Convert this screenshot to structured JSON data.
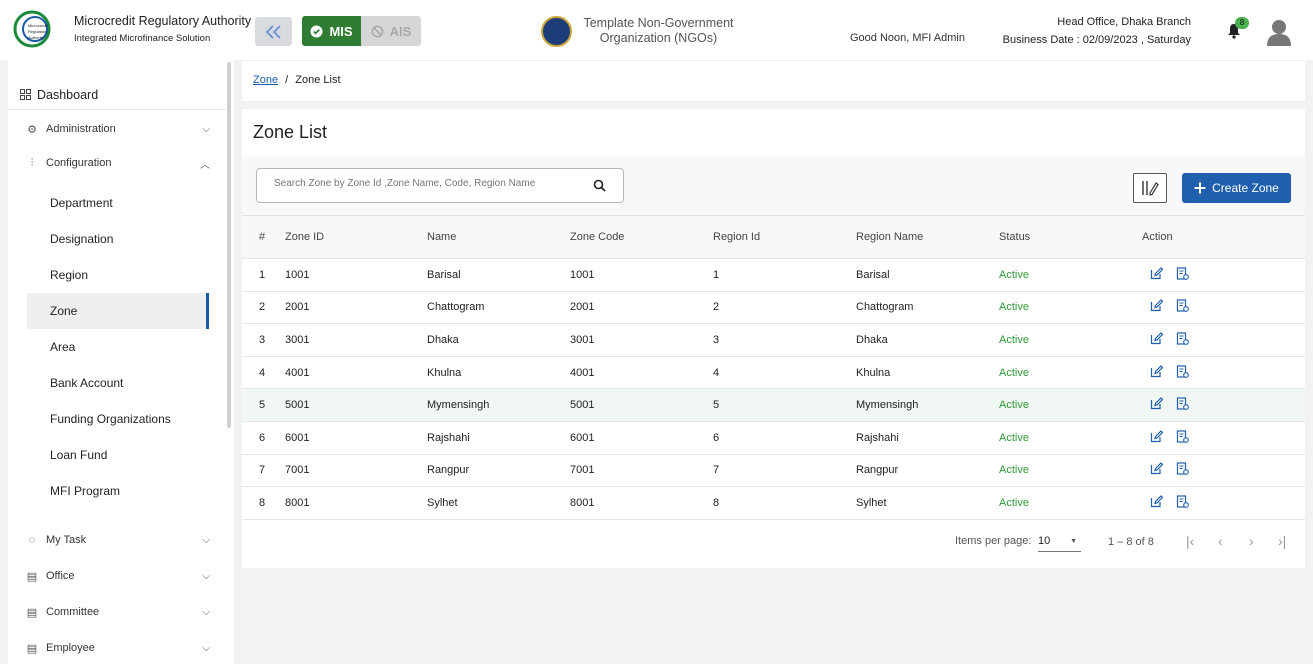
{
  "header": {
    "org_title": "Microcredit Regulatory Authority",
    "org_subtitle": "Integrated Microfinance Solution",
    "logo_text": "Microcredit Regulatory Authority",
    "mis_label": "MIS",
    "ais_label": "AIS",
    "ngo_name": "Template Non-Government Organization (NGOs)",
    "greeting": "Good Noon, MFI Admin",
    "branch": "Head Office, Dhaka Branch",
    "business_date": "Business Date : 02/09/2023 , Saturday",
    "notification_count": "8"
  },
  "sidebar": {
    "dashboard": "Dashboard",
    "items": [
      {
        "label": "Administration",
        "icon": "users-cog-icon",
        "chevron": "down"
      },
      {
        "label": "Configuration",
        "icon": "sliders-icon",
        "chevron": "up"
      }
    ],
    "config_children": [
      "Department",
      "Designation",
      "Region",
      "Zone",
      "Area",
      "Bank Account",
      "Funding Organizations",
      "Loan Fund",
      "MFI Program"
    ],
    "active_child": "Zone",
    "bottom_items": [
      {
        "label": "My Task",
        "icon": "task-icon"
      },
      {
        "label": "Office",
        "icon": "office-icon"
      },
      {
        "label": "Committee",
        "icon": "committee-icon"
      },
      {
        "label": "Employee",
        "icon": "employee-icon"
      }
    ]
  },
  "breadcrumb": {
    "link": "Zone",
    "separator": "/",
    "current": "Zone List"
  },
  "page": {
    "title": "Zone List",
    "search_placeholder": "Search Zone by Zone Id ,Zone Name, Code, Region Name",
    "create_label": "Create Zone"
  },
  "table": {
    "headers": [
      "#",
      "Zone ID",
      "Name",
      "Zone Code",
      "Region Id",
      "Region Name",
      "Status",
      "Action"
    ],
    "rows": [
      [
        "1",
        "1001",
        "Barisal",
        "1001",
        "1",
        "Barisal",
        "Active"
      ],
      [
        "2",
        "2001",
        "Chattogram",
        "2001",
        "2",
        "Chattogram",
        "Active"
      ],
      [
        "3",
        "3001",
        "Dhaka",
        "3001",
        "3",
        "Dhaka",
        "Active"
      ],
      [
        "4",
        "4001",
        "Khulna",
        "4001",
        "4",
        "Khulna",
        "Active"
      ],
      [
        "5",
        "5001",
        "Mymensingh",
        "5001",
        "5",
        "Mymensingh",
        "Active"
      ],
      [
        "6",
        "6001",
        "Rajshahi",
        "6001",
        "6",
        "Rajshahi",
        "Active"
      ],
      [
        "7",
        "7001",
        "Rangpur",
        "7001",
        "7",
        "Rangpur",
        "Active"
      ],
      [
        "8",
        "8001",
        "Sylhet",
        "8001",
        "8",
        "Sylhet",
        "Active"
      ]
    ],
    "highlighted_row": 4
  },
  "pager": {
    "items_per_page_label": "Items per page:",
    "items_per_page": "10",
    "range": "1 – 8 of 8"
  },
  "colors": {
    "primary": "#1f5fae",
    "mis_green": "#2e7d32",
    "status_green": "#2e9a37"
  }
}
